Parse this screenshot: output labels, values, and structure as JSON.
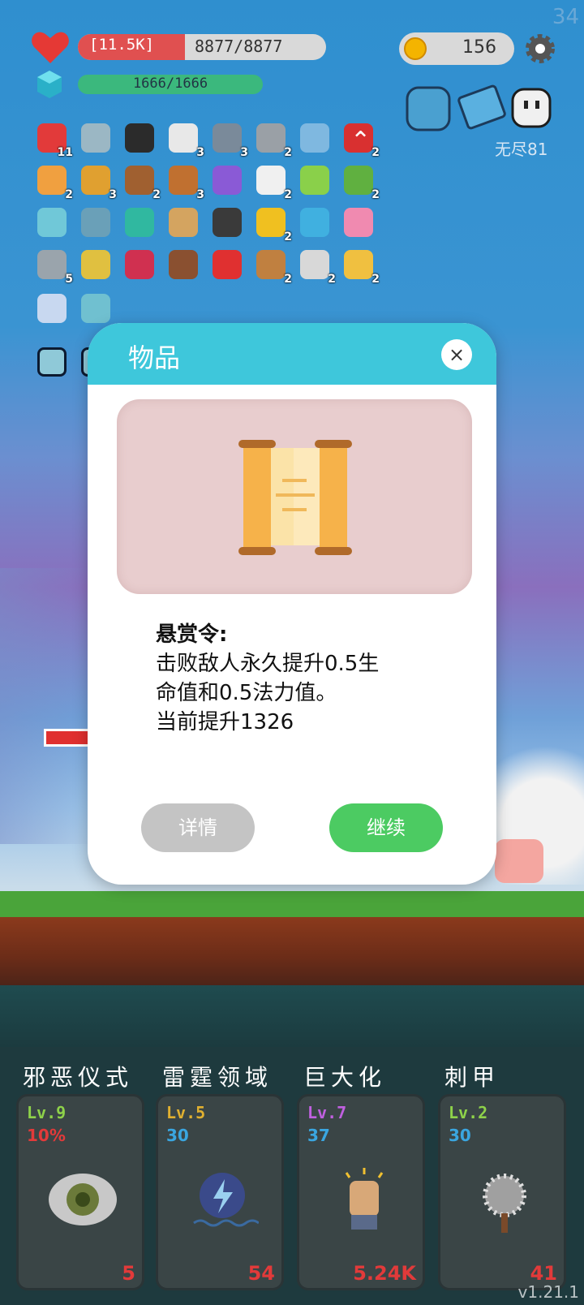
{
  "fps": "34",
  "hud": {
    "hp_shield": "[11.5K]",
    "hp_value": "8877/8877",
    "mp_value": "1666/1666",
    "gold": "156",
    "endless_label": "无尽81"
  },
  "inventory": {
    "rows": [
      [
        {
          "icon": "apple-icon",
          "count": "11",
          "color": "#e23a3a"
        },
        {
          "icon": "ghost-hands-icon",
          "count": "",
          "color": "#9bb7c4"
        },
        {
          "icon": "sword-icon",
          "count": "",
          "color": "#2b2b2b"
        },
        {
          "icon": "pill-icon",
          "count": "3",
          "color": "#e8e8e8"
        },
        {
          "icon": "dagger-icon",
          "count": "3",
          "color": "#7a8a9a"
        },
        {
          "icon": "axe-icon",
          "count": "2",
          "color": "#9aa0a6"
        },
        {
          "icon": "id-card-icon",
          "count": "",
          "color": "#7fb8e0"
        },
        {
          "icon": "bookmark-icon",
          "count": "2",
          "color": "#d93030"
        }
      ],
      [
        {
          "icon": "briefcase-icon",
          "count": "2",
          "color": "#f0a040"
        },
        {
          "icon": "book-icon",
          "count": "3",
          "color": "#e0a030"
        },
        {
          "icon": "door-icon",
          "count": "2",
          "color": "#a06030"
        },
        {
          "icon": "target-icon",
          "count": "3",
          "color": "#c07030"
        },
        {
          "icon": "mystery-box-icon",
          "count": "",
          "color": "#8a5ad6"
        },
        {
          "icon": "flower-icon",
          "count": "2",
          "color": "#f0f0f0"
        },
        {
          "icon": "potion-green-icon",
          "count": "",
          "color": "#8ad04a"
        },
        {
          "icon": "flask-icon",
          "count": "2",
          "color": "#60b040"
        }
      ],
      [
        {
          "icon": "wand-icon",
          "count": "",
          "color": "#70c8d8"
        },
        {
          "icon": "dots-icon",
          "count": "",
          "color": "#6aa0b8"
        },
        {
          "icon": "spiral-icon",
          "count": "",
          "color": "#30b8a0"
        },
        {
          "icon": "scroll-icon",
          "count": "",
          "color": "#d4a460"
        },
        {
          "icon": "viking-helmet-icon",
          "count": "",
          "color": "#3a3a3a"
        },
        {
          "icon": "sunflower-icon",
          "count": "2",
          "color": "#f0c020"
        },
        {
          "icon": "chat-bubble-icon",
          "count": "",
          "color": "#40b0e0"
        },
        {
          "icon": "ice-cream-icon",
          "count": "",
          "color": "#f08ab0"
        }
      ],
      [
        {
          "icon": "knife-icon",
          "count": "5",
          "color": "#9aa4ac"
        },
        {
          "icon": "ring-icon",
          "count": "",
          "color": "#e0c040"
        },
        {
          "icon": "jam-jar-icon",
          "count": "",
          "color": "#d03050"
        },
        {
          "icon": "mushroom-icon",
          "count": "",
          "color": "#8a5030"
        },
        {
          "icon": "red-potion-icon",
          "count": "",
          "color": "#e03030"
        },
        {
          "icon": "bow-icon",
          "count": "2",
          "color": "#c08040"
        },
        {
          "icon": "meteor-icon",
          "count": "2",
          "color": "#d8d8d8"
        },
        {
          "icon": "beer-icon",
          "count": "2",
          "color": "#f0c040"
        }
      ],
      [
        {
          "icon": "capsule-icon",
          "count": "",
          "color": "#c8d8f0"
        },
        {
          "icon": "paper-scroll-icon",
          "count": "",
          "color": "#70c0d0"
        }
      ],
      [
        {
          "icon": "rune-tile-icon",
          "count": "",
          "color": "#8fc9d8"
        },
        {
          "icon": "rune-tile-icon",
          "count": "",
          "color": "#8fc9d8"
        }
      ]
    ]
  },
  "modal": {
    "title": "物品",
    "close": "×",
    "item_name": "悬赏令:",
    "description_line1": "击败敌人永久提升0.5生",
    "description_line2": "命值和0.5法力值。",
    "description_line3": "当前提升1326",
    "detail_button": "详情",
    "continue_button": "继续"
  },
  "skills": [
    {
      "name": "邪恶仪式",
      "level": "Lv.9",
      "level_color": "#8ed24a",
      "sub": "10%",
      "sub_color": "#e23a3a",
      "cost": "5",
      "icon": "eye-icon"
    },
    {
      "name": "雷霆领域",
      "level": "Lv.5",
      "level_color": "#e0b030",
      "sub": "30",
      "sub_color": "#3aa6e0",
      "cost": "54",
      "icon": "lightning-gear-icon"
    },
    {
      "name": "巨大化",
      "level": "Lv.7",
      "level_color": "#c060e0",
      "sub": "37",
      "sub_color": "#3aa6e0",
      "cost": "5.24K",
      "icon": "fist-icon"
    },
    {
      "name": "刺甲",
      "level": "Lv.2",
      "level_color": "#8ed24a",
      "sub": "30",
      "sub_color": "#3aa6e0",
      "cost": "41",
      "icon": "spiked-mace-icon"
    }
  ],
  "version": "v1.21.1"
}
